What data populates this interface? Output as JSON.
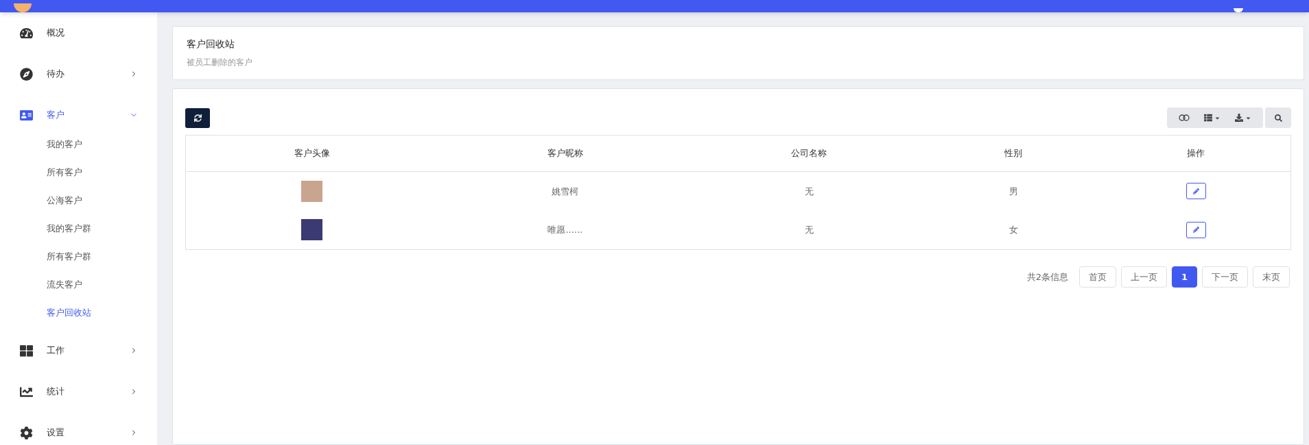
{
  "sidebar": {
    "items": [
      {
        "label": "概况",
        "selected": false
      },
      {
        "label": "待办",
        "selected": false,
        "expanded": false
      },
      {
        "label": "客户",
        "selected": true,
        "expanded": true,
        "children": [
          {
            "label": "我的客户",
            "selected": false
          },
          {
            "label": "所有客户",
            "selected": false
          },
          {
            "label": "公海客户",
            "selected": false
          },
          {
            "label": "我的客户群",
            "selected": false
          },
          {
            "label": "所有客户群",
            "selected": false
          },
          {
            "label": "流失客户",
            "selected": false
          },
          {
            "label": "客户回收站",
            "selected": true
          }
        ]
      },
      {
        "label": "工作",
        "selected": false,
        "expanded": false
      },
      {
        "label": "统计",
        "selected": false,
        "expanded": false
      },
      {
        "label": "设置",
        "selected": false,
        "expanded": false
      }
    ]
  },
  "header": {
    "title": "客户回收站",
    "subtitle": "被员工删除的客户"
  },
  "table": {
    "columns": [
      "客户头像",
      "客户昵称",
      "公司名称",
      "性别",
      "操作"
    ],
    "rows": [
      {
        "nickname": "姚雪柯",
        "company": "无",
        "gender": "男"
      },
      {
        "nickname": "唯愿......",
        "company": "无",
        "gender": "女"
      }
    ]
  },
  "pagination": {
    "summary": "共2条信息",
    "buttons": [
      {
        "label": "首页",
        "selected": false
      },
      {
        "label": "上一页",
        "selected": false
      },
      {
        "label": "1",
        "selected": true
      },
      {
        "label": "下一页",
        "selected": false
      },
      {
        "label": "末页",
        "selected": false
      }
    ]
  }
}
